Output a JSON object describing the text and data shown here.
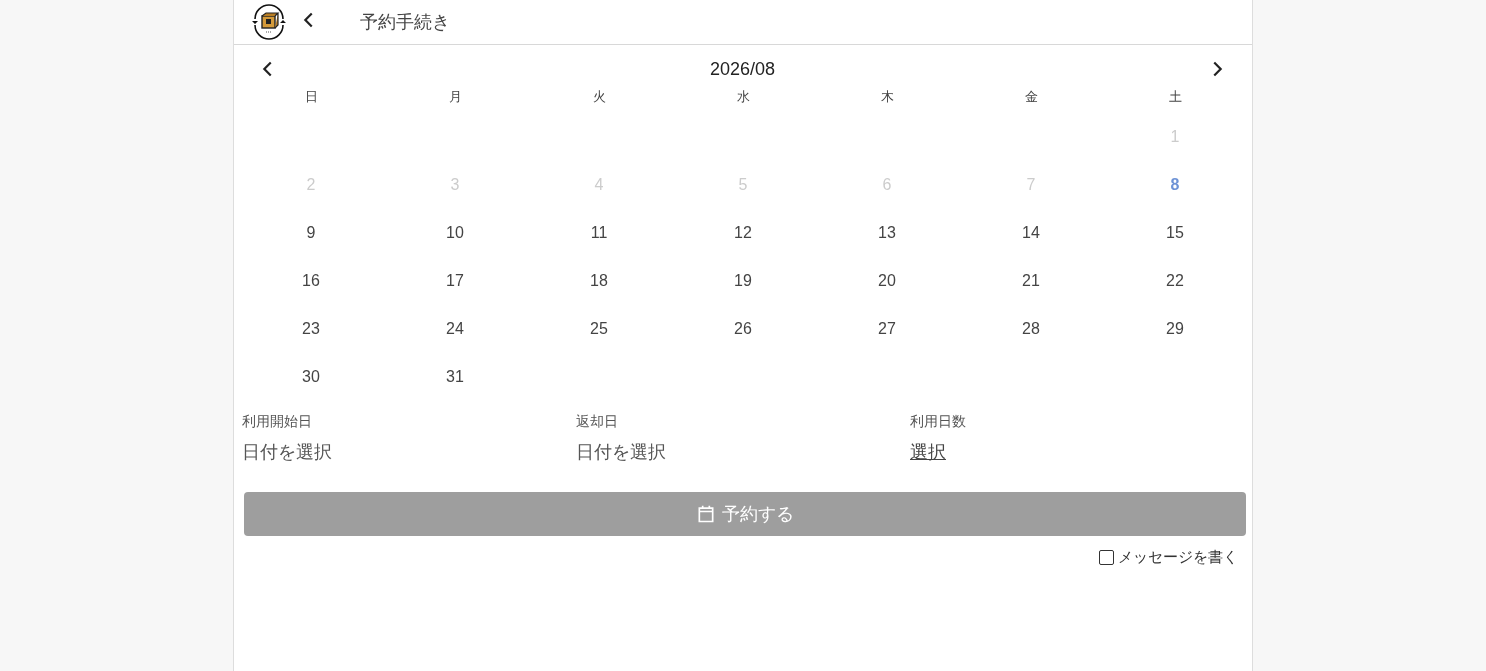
{
  "header": {
    "title": "予約手続き"
  },
  "calendar": {
    "month": "2026/08",
    "weekdays": [
      "日",
      "月",
      "火",
      "水",
      "木",
      "金",
      "土"
    ],
    "days": [
      {
        "kind": "blank"
      },
      {
        "kind": "blank"
      },
      {
        "kind": "blank"
      },
      {
        "kind": "blank"
      },
      {
        "kind": "blank"
      },
      {
        "kind": "blank"
      },
      {
        "kind": "disabled",
        "label": "1"
      },
      {
        "kind": "disabled",
        "label": "2"
      },
      {
        "kind": "disabled",
        "label": "3"
      },
      {
        "kind": "disabled",
        "label": "4"
      },
      {
        "kind": "disabled",
        "label": "5"
      },
      {
        "kind": "disabled",
        "label": "6"
      },
      {
        "kind": "disabled",
        "label": "7"
      },
      {
        "kind": "today",
        "label": "8"
      },
      {
        "kind": "normal",
        "label": "9"
      },
      {
        "kind": "normal",
        "label": "10"
      },
      {
        "kind": "normal",
        "label": "11"
      },
      {
        "kind": "normal",
        "label": "12"
      },
      {
        "kind": "normal",
        "label": "13"
      },
      {
        "kind": "normal",
        "label": "14"
      },
      {
        "kind": "normal",
        "label": "15"
      },
      {
        "kind": "normal",
        "label": "16"
      },
      {
        "kind": "normal",
        "label": "17"
      },
      {
        "kind": "normal",
        "label": "18"
      },
      {
        "kind": "normal",
        "label": "19"
      },
      {
        "kind": "normal",
        "label": "20"
      },
      {
        "kind": "normal",
        "label": "21"
      },
      {
        "kind": "normal",
        "label": "22"
      },
      {
        "kind": "normal",
        "label": "23"
      },
      {
        "kind": "normal",
        "label": "24"
      },
      {
        "kind": "normal",
        "label": "25"
      },
      {
        "kind": "normal",
        "label": "26"
      },
      {
        "kind": "normal",
        "label": "27"
      },
      {
        "kind": "normal",
        "label": "28"
      },
      {
        "kind": "normal",
        "label": "29"
      },
      {
        "kind": "normal",
        "label": "30"
      },
      {
        "kind": "normal",
        "label": "31"
      }
    ]
  },
  "fields": [
    {
      "kind": "picker",
      "label": "利用開始日",
      "value": "日付を選択"
    },
    {
      "kind": "picker",
      "label": "返却日",
      "value": "日付を選択"
    },
    {
      "kind": "link",
      "label": "利用日数",
      "value": "選択"
    }
  ],
  "reserve_button": {
    "label": "予約する",
    "disabled": true
  },
  "message_checkbox": {
    "label": "メッセージを書く",
    "checked": false
  }
}
